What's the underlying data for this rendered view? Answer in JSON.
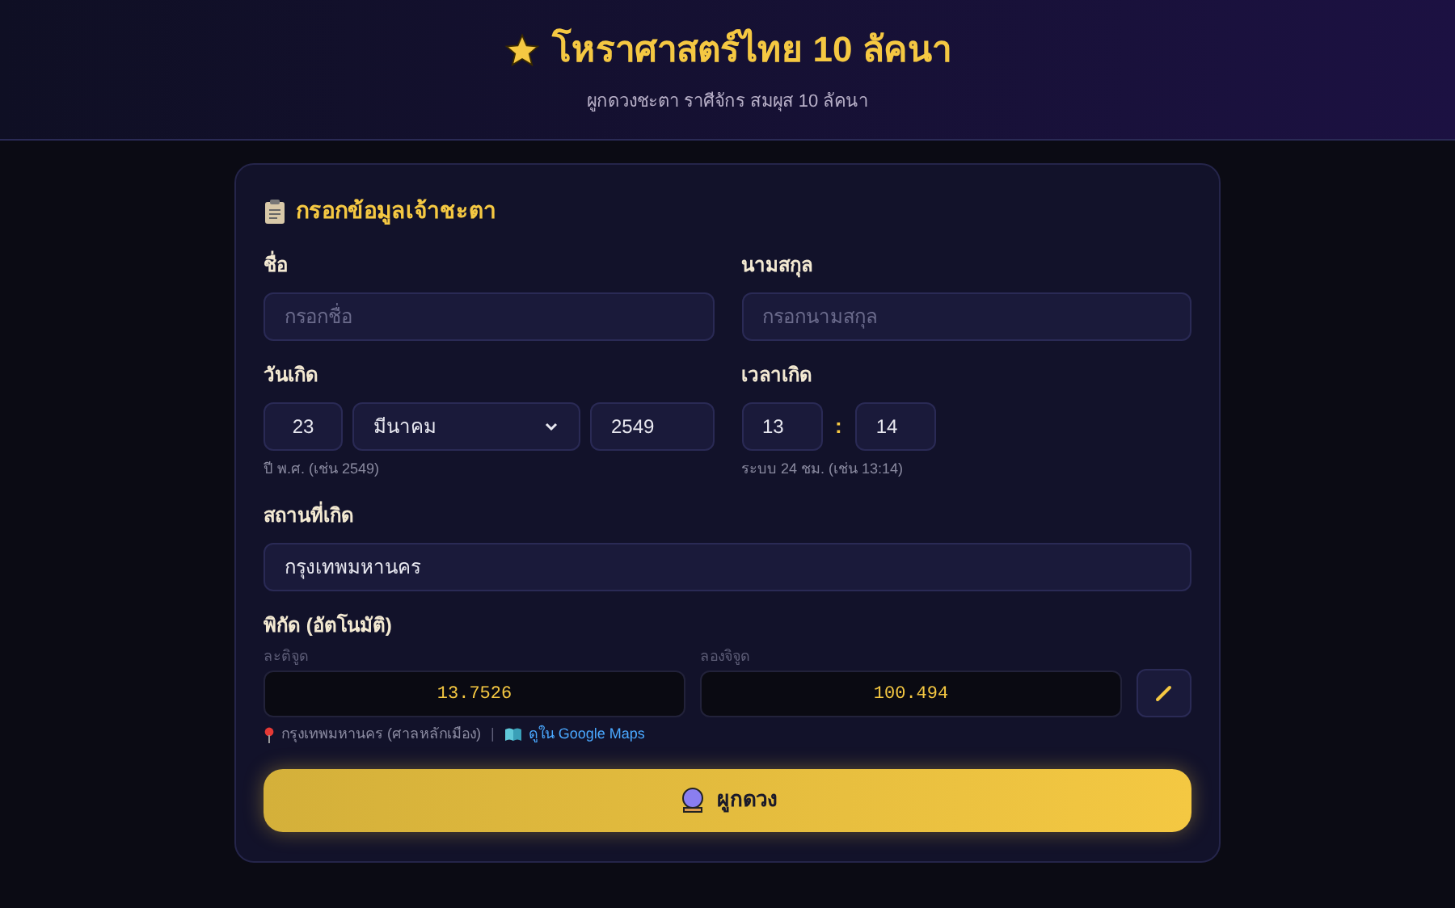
{
  "header": {
    "title": "โหราศาสตร์ไทย 10 ลัคนา",
    "subtitle": "ผูกดวงชะตา ราศีจักร สมผุส 10 ลัคนา"
  },
  "form": {
    "title": "กรอกข้อมูลเจ้าชะตา",
    "first_name": {
      "label": "ชื่อ",
      "placeholder": "กรอกชื่อ"
    },
    "last_name": {
      "label": "นามสกุล",
      "placeholder": "กรอกนามสกุล"
    },
    "birth_date": {
      "label": "วันเกิด",
      "day": "23",
      "month": "มีนาคม",
      "year": "2549",
      "hint": "ปี พ.ศ. (เช่น 2549)"
    },
    "birth_time": {
      "label": "เวลาเกิด",
      "hour": "13",
      "separator": ":",
      "minute": "14",
      "hint": "ระบบ 24 ชม. (เช่น 13:14)"
    },
    "birth_place": {
      "label": "สถานที่เกิด",
      "value": "กรุงเทพมหานคร"
    },
    "coordinates": {
      "label": "พิกัด (อัตโนมัติ)",
      "latitude_label": "ละติจูด",
      "latitude": "13.7526",
      "longitude_label": "ลองจิจูด",
      "longitude": "100.494",
      "location_note": "กรุงเทพมหานคร (ศาลหลักเมือง)",
      "divider": "|",
      "map_link": "ดูใน Google Maps"
    },
    "submit": "ผูกดวง"
  }
}
